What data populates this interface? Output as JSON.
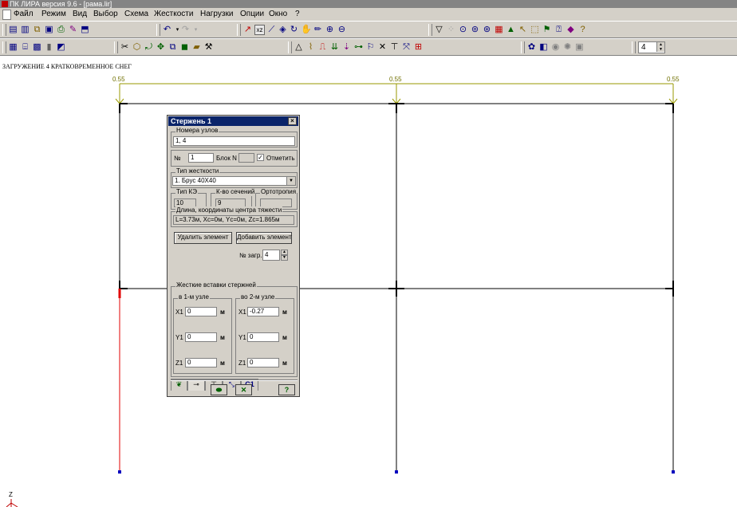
{
  "window": {
    "title": "ПК ЛИРА  версия 9.6 - [рама.lir]"
  },
  "menu": [
    "Файл",
    "Режим",
    "Вид",
    "Выбор",
    "Схема",
    "Жесткости",
    "Нагрузки",
    "Опции",
    "Окно",
    "?"
  ],
  "toolbar": {
    "load_number": "4"
  },
  "canvas": {
    "caption": "ЗАГРУЖЕНИЕ 4 КРАТКОВРЕМЕННОЕ СНЕГ",
    "load_values": [
      "0.55",
      "0.55",
      "0.55"
    ],
    "axis_label": "Z"
  },
  "dialog": {
    "title": "Стержень  1",
    "close": "×",
    "nodes_group": "Номера узлов",
    "nodes_value": "1, 4",
    "num_label": "№",
    "num_value": "1",
    "block_label": "Блок N",
    "block_value": "",
    "mark_label": "Отметить",
    "mark_checked": "✓",
    "stiffness_group": "Тип жесткости",
    "stiffness_value": "1. Брус 40Х40",
    "ke_type_label": "Тип КЭ",
    "ke_type_value": "10",
    "sections_label": "К-во сечений",
    "sections_value": "9",
    "ortho_label": "Ортотропия",
    "ortho_value": "",
    "length_group": "Длина, координаты центра тяжести",
    "length_value": "L=3.73м, Xc=0м, Yc=0м, Zc=1.865м",
    "delete_button": "Удалить элемент",
    "add_button": "Добавить элемент",
    "load_label": "№ загр.",
    "load_value": "4",
    "tab_c1": "C1",
    "inserts_group": "Жесткие вставки стержней",
    "node1_group": "в 1-м узле",
    "node2_group": "во 2-м узле",
    "node1": {
      "x1": "0",
      "y1": "0",
      "z1": "0"
    },
    "node2": {
      "x1": "-0.27",
      "y1": "0",
      "z1": "0"
    },
    "x1_label": "X1",
    "y1_label": "Y1",
    "z1_label": "Z1",
    "unit": "м",
    "help_button": "?"
  }
}
